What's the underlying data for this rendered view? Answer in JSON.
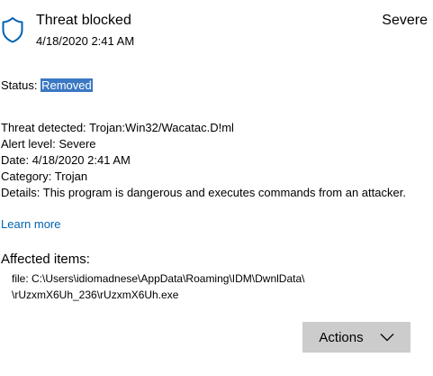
{
  "header": {
    "title": "Threat blocked",
    "severity": "Severe",
    "timestamp": "4/18/2020 2:41 AM",
    "icon": "shield-icon"
  },
  "status": {
    "label": "Status:",
    "value": "Removed"
  },
  "details": {
    "threat_label": "Threat detected:",
    "threat_value": "Trojan:Win32/Wacatac.D!ml",
    "alert_label": "Alert level:",
    "alert_value": "Severe",
    "date_label": "Date:",
    "date_value": "4/18/2020 2:41 AM",
    "category_label": "Category:",
    "category_value": "Trojan",
    "details_label": "Details:",
    "details_value": "This program is dangerous and executes commands from an attacker."
  },
  "learn_more": "Learn more",
  "affected": {
    "title": "Affected items:",
    "line1": "file: C:\\Users\\idiomadnese\\AppData\\Roaming\\IDM\\DwnlData\\",
    "line2": "\\rUzxmX6Uh_236\\rUzxmX6Uh.exe"
  },
  "actions": {
    "label": "Actions",
    "icon": "chevron-down-icon"
  },
  "colors": {
    "link": "#0063b1",
    "selection": "#3b78c4",
    "button": "#cccccc",
    "shield_stroke": "#0063b1"
  }
}
